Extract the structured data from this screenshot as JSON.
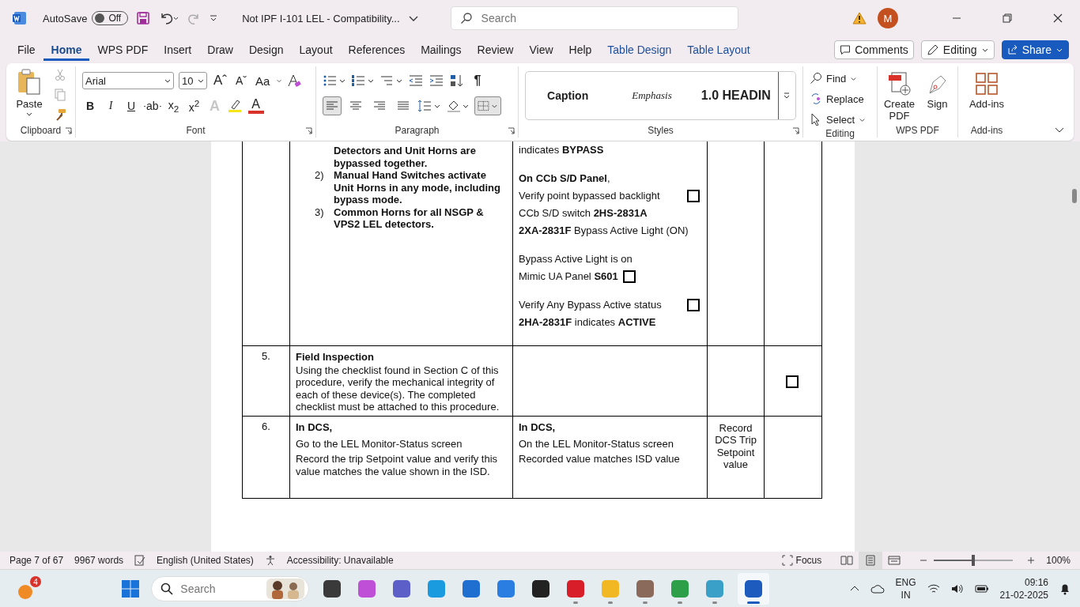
{
  "titlebar": {
    "autosave_label": "AutoSave",
    "autosave": {
      "on": false,
      "label": "Off"
    },
    "document_title": "Not IPF I-101 LEL  -  Compatibility...",
    "search": {
      "placeholder": "Search"
    },
    "account_initial": "M"
  },
  "tabs": [
    {
      "label": "File",
      "selected": false,
      "kind": "plain"
    },
    {
      "label": "Home",
      "selected": true,
      "kind": "plain"
    },
    {
      "label": "WPS PDF",
      "selected": false,
      "kind": "plain"
    },
    {
      "label": "Insert",
      "selected": false,
      "kind": "plain"
    },
    {
      "label": "Draw",
      "selected": false,
      "kind": "plain"
    },
    {
      "label": "Design",
      "selected": false,
      "kind": "plain"
    },
    {
      "label": "Layout",
      "selected": false,
      "kind": "plain"
    },
    {
      "label": "References",
      "selected": false,
      "kind": "plain"
    },
    {
      "label": "Mailings",
      "selected": false,
      "kind": "plain"
    },
    {
      "label": "Review",
      "selected": false,
      "kind": "plain"
    },
    {
      "label": "View",
      "selected": false,
      "kind": "plain"
    },
    {
      "label": "Help",
      "selected": false,
      "kind": "plain"
    },
    {
      "label": "Table Design",
      "selected": false,
      "kind": "context"
    },
    {
      "label": "Table Layout",
      "selected": false,
      "kind": "context"
    }
  ],
  "actions": {
    "comments": "Comments",
    "mode": "Editing",
    "share": "Share"
  },
  "clipboard": {
    "title": "Clipboard",
    "paste": "Paste"
  },
  "font": {
    "title": "Font",
    "name": "Arial",
    "size": "10",
    "top_tools": [
      {
        "kind": "grow",
        "label": "Aˆ"
      },
      {
        "kind": "shrink",
        "label": "Aˇ"
      },
      {
        "kind": "case",
        "label": "Aa"
      }
    ],
    "tools": [
      {
        "kind": "bold",
        "label": "B"
      },
      {
        "kind": "italic",
        "label": "I"
      },
      {
        "kind": "underline",
        "label": "U"
      },
      {
        "kind": "strike",
        "label": "ab"
      },
      {
        "kind": "sub",
        "label": "x$_{2}$"
      },
      {
        "kind": "super",
        "label": "x$^{2}$"
      },
      {
        "kind": "effects",
        "label": "A",
        "disabled": true
      },
      {
        "kind": "color",
        "label": "A",
        "disabled": false
      }
    ]
  },
  "paragraph": {
    "title": "Paragraph",
    "pilcrow": "¶",
    "align": [
      {
        "kind": "left",
        "selected": true
      },
      {
        "kind": "center",
        "selected": false
      },
      {
        "kind": "right",
        "selected": false
      },
      {
        "kind": "justify",
        "selected": false
      }
    ],
    "borders_selected": true
  },
  "styles": {
    "title": "Styles",
    "items": [
      {
        "kind": "caption",
        "label": "Caption"
      },
      {
        "kind": "emphasis",
        "label": "Emphasis"
      },
      {
        "kind": "heading",
        "label": "1.0  HEADIN"
      }
    ]
  },
  "editing": {
    "title": "Editing",
    "items": [
      {
        "kind": "find",
        "label": "Find"
      },
      {
        "kind": "replace",
        "label": "Replace"
      },
      {
        "kind": "select",
        "label": "Select"
      }
    ]
  },
  "wps": {
    "title": "WPS PDF",
    "items": [
      {
        "kind": "pdf",
        "label": "Create PDF"
      },
      {
        "kind": "sign",
        "label": "Sign"
      }
    ]
  },
  "addins": {
    "title": "Add-ins",
    "label": "Add-ins"
  },
  "table": {
    "rows": [
      {
        "steps": [
          {
            "text": "Detectors and Unit Horns are bypassed together."
          },
          {
            "marker": "2)",
            "text": "Manual Hand Switches activate Unit Horns in any mode, including bypass mode."
          },
          {
            "marker": "3)",
            "text": "Common Horns for all NSGP & VPS2 LEL detectors."
          }
        ],
        "verification": [
          {
            "kind": "text",
            "text": "indicates **BYPASS**"
          },
          {
            "kind": "text",
            "text": "**On CCb S/D Panel**,"
          },
          {
            "kind": "check-right",
            "text": "Verify point bypassed backlight",
            "checked": false
          },
          {
            "kind": "text",
            "text": "CCb S/D switch **2HS-2831A**"
          },
          {
            "kind": "text",
            "text": "**2XA-2831F** Bypass Active Light (ON)"
          },
          {
            "kind": "text",
            "text": "Bypass Active Light is on"
          },
          {
            "kind": "check-inline",
            "text": "Mimic UA Panel **S601**",
            "checked": false
          },
          {
            "kind": "check-right",
            "text": "Verify Any Bypass Active status",
            "checked": false
          },
          {
            "kind": "text",
            "text": "**2HA-2831F** indicates **ACTIVE**"
          }
        ]
      },
      {
        "number": "5.",
        "heading": "Field Inspection",
        "paragraphs": [
          "Using the checklist found in Section C of this procedure, verify the mechanical integrity of each of these device(s). The completed checklist must be attached to this procedure."
        ],
        "sign_checkbox": {
          "checked": false
        }
      },
      {
        "number": "6.",
        "heading": "In DCS,",
        "paragraphs": [
          "Go to the LEL Monitor-Status screen",
          "Record the trip Setpoint value and verify this value matches the value shown in the ISD."
        ],
        "verification_heading": "In DCS,",
        "verification": [
          {
            "kind": "text",
            "text": "On the LEL Monitor-Status screen"
          },
          {
            "kind": "text",
            "text": "Recorded value matches ISD value"
          }
        ],
        "record": "Record DCS Trip Setpoint value"
      }
    ]
  },
  "status_bar": {
    "page": "Page 7 of 67",
    "words": "9967 words",
    "language": "English (United States)",
    "accessibility": "Accessibility: Unavailable",
    "focus": "Focus",
    "views": [
      {
        "kind": "read",
        "selected": false
      },
      {
        "kind": "print",
        "selected": true
      },
      {
        "kind": "web",
        "selected": false
      }
    ],
    "zoom": {
      "level": 0.5,
      "label": "100%"
    }
  },
  "taskbar": {
    "weather_badge": "4",
    "search": {
      "placeholder": "Search"
    },
    "apps": [
      {
        "color": "#3a3a3a",
        "running": false
      },
      {
        "color": "#c04fd8",
        "running": false
      },
      {
        "color": "#5b5fc7",
        "running": false
      },
      {
        "color": "#1a9be0",
        "running": false
      },
      {
        "color": "#1f6fd0",
        "running": false
      },
      {
        "color": "#2a7de1",
        "running": false
      },
      {
        "color": "#222222",
        "running": false
      },
      {
        "color": "#d81e28",
        "running": true
      },
      {
        "color": "#f2b824",
        "running": true
      },
      {
        "color": "#8a6a5a",
        "running": true
      },
      {
        "color": "#2e9f49",
        "running": true
      },
      {
        "color": "#3aa0c8",
        "running": true
      },
      {
        "color": "#1e5bbf",
        "running": true,
        "active": true
      }
    ],
    "language": "ENG",
    "region": "IN",
    "time": "09:16",
    "date": "21-02-2025"
  }
}
